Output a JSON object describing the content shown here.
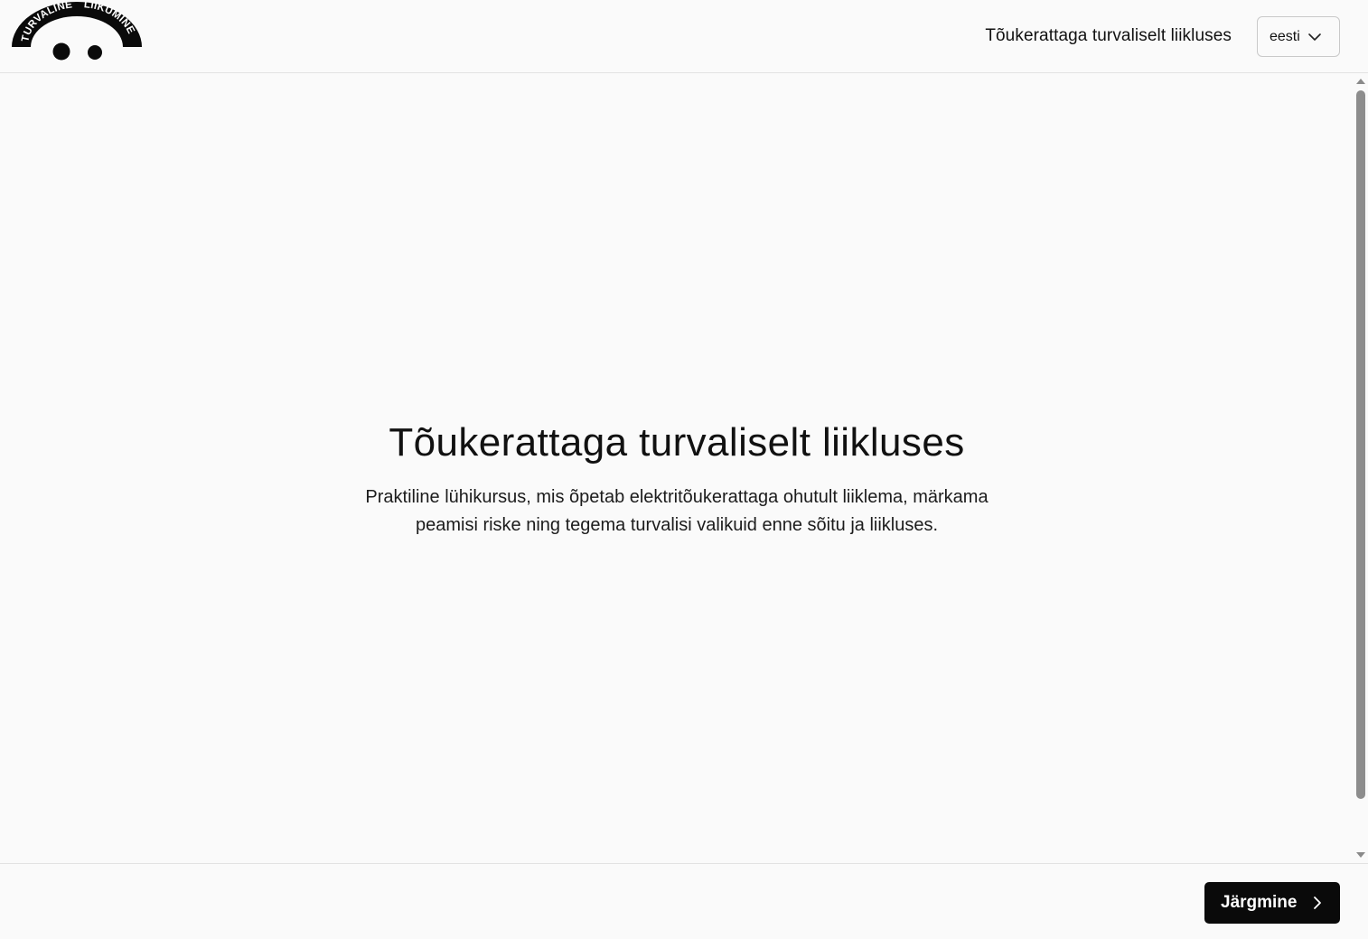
{
  "logo": {
    "text_left": "TURVALINE",
    "text_right": "LIIKUMINE"
  },
  "header": {
    "title": "Tõukerattaga turvaliselt liikluses",
    "language": {
      "selected": "eesti",
      "icon": "chevron-down-icon"
    }
  },
  "main": {
    "title": "Tõukerattaga turvaliselt liikluses",
    "subtitle": "Praktiline lühikursus, mis õpetab elektritõukerattaga ohutult liiklema, märkama peamisi riske ning tegema turvalisi valikuid enne sõitu ja liikluses."
  },
  "footer": {
    "next_label": "Järgmine",
    "next_icon": "chevron-right-icon"
  },
  "colors": {
    "background": "#fafafa",
    "button": "#0a0a0a",
    "text": "#111111"
  }
}
